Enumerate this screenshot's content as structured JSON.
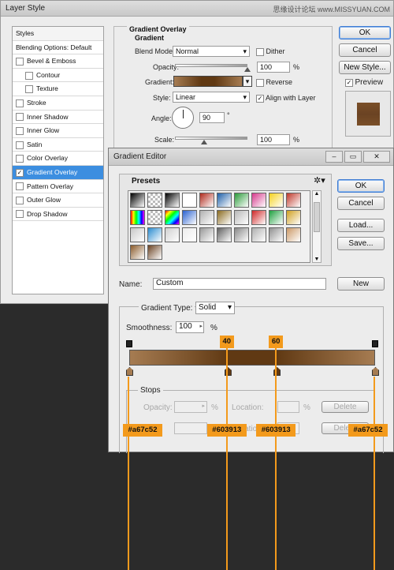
{
  "layer_style": {
    "title": "Layer Style",
    "styles_header": "Styles",
    "styles": [
      {
        "label": "Blending Options: Default",
        "checkbox": false,
        "checked": false,
        "selected": false,
        "indent": 0
      },
      {
        "label": "Bevel & Emboss",
        "checkbox": true,
        "checked": false,
        "selected": false,
        "indent": 0
      },
      {
        "label": "Contour",
        "checkbox": true,
        "checked": false,
        "selected": false,
        "indent": 1
      },
      {
        "label": "Texture",
        "checkbox": true,
        "checked": false,
        "selected": false,
        "indent": 1
      },
      {
        "label": "Stroke",
        "checkbox": true,
        "checked": false,
        "selected": false,
        "indent": 0
      },
      {
        "label": "Inner Shadow",
        "checkbox": true,
        "checked": false,
        "selected": false,
        "indent": 0
      },
      {
        "label": "Inner Glow",
        "checkbox": true,
        "checked": false,
        "selected": false,
        "indent": 0
      },
      {
        "label": "Satin",
        "checkbox": true,
        "checked": false,
        "selected": false,
        "indent": 0
      },
      {
        "label": "Color Overlay",
        "checkbox": true,
        "checked": false,
        "selected": false,
        "indent": 0
      },
      {
        "label": "Gradient Overlay",
        "checkbox": true,
        "checked": true,
        "selected": true,
        "indent": 0
      },
      {
        "label": "Pattern Overlay",
        "checkbox": true,
        "checked": false,
        "selected": false,
        "indent": 0
      },
      {
        "label": "Outer Glow",
        "checkbox": true,
        "checked": false,
        "selected": false,
        "indent": 0
      },
      {
        "label": "Drop Shadow",
        "checkbox": true,
        "checked": false,
        "selected": false,
        "indent": 0
      }
    ],
    "group_title": "Gradient Overlay",
    "subgroup_title": "Gradient",
    "blend_mode_label": "Blend Mode:",
    "blend_mode_value": "Normal",
    "dither_label": "Dither",
    "opacity_label": "Opacity:",
    "opacity_value": "100",
    "opacity_unit": "%",
    "opacity_fraction": 1.0,
    "gradient_label": "Gradient:",
    "reverse_label": "Reverse",
    "style_label": "Style:",
    "style_value": "Linear",
    "align_label": "Align with Layer",
    "angle_label": "Angle:",
    "angle_value": "90",
    "angle_unit": "°",
    "scale_label": "Scale:",
    "scale_value": "100",
    "scale_unit": "%",
    "scale_fraction": 0.4,
    "ok_label": "OK",
    "cancel_label": "Cancel",
    "new_style_label": "New Style...",
    "preview_label": "Preview",
    "preview_color": "#6b4323"
  },
  "gradient_editor": {
    "title": "Gradient Editor",
    "presets_label": "Presets",
    "ok_label": "OK",
    "cancel_label": "Cancel",
    "load_label": "Load...",
    "save_label": "Save...",
    "name_label": "Name:",
    "name_value": "Custom",
    "new_label": "New",
    "gradient_type_label": "Gradient Type:",
    "gradient_type_value": "Solid",
    "smoothness_label": "Smoothness:",
    "smoothness_value": "100",
    "smoothness_unit": "%",
    "stops_label": "Stops",
    "opacity_label": "Opacity:",
    "opacity_unit": "%",
    "location_label": "Location:",
    "location_unit": "%",
    "delete_label": "Delete",
    "color_label": "r:",
    "color_location_label": "Location:",
    "color_stops": [
      {
        "location": 0,
        "color": "#a67c52",
        "label": "#a67c52"
      },
      {
        "location": 40,
        "color": "#603913",
        "label": "#603913"
      },
      {
        "location": 60,
        "color": "#603913",
        "label": "#603913"
      },
      {
        "location": 100,
        "color": "#a67c52",
        "label": "#a67c52"
      }
    ],
    "callout_40": "40",
    "callout_60": "60",
    "presets": [
      [
        "#000000",
        "checker",
        "#000000",
        "#ffffff",
        "#b02a1c",
        "#1e5fa8",
        "#2b9a3a",
        "#d63a8c",
        "#f5d21e",
        "#c0392b"
      ],
      [
        "rainbow",
        "checker",
        "rainbow2",
        "#2a61d0",
        "#b0b0b0",
        "#8a6b20",
        "#b8b8b8",
        "#d02828",
        "#20a040",
        "#d0a020"
      ],
      [
        "#c8c8c8",
        "#2a8cd0",
        "#d0d0d0",
        "#ececec",
        "#999999",
        "#606060",
        "#888888",
        "#b0b0b0",
        "#909090",
        "#cc9966"
      ],
      [
        "#8a5a2a",
        "#6b4323"
      ]
    ]
  },
  "watermark": "思缘设计论坛 www.MISSYUAN.COM"
}
